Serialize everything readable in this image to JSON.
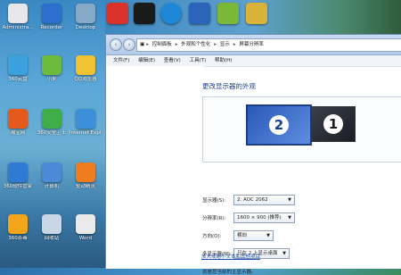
{
  "desktop": {
    "icons": [
      {
        "label": "Administra...",
        "color": "#e7e7ea"
      },
      {
        "label": "Recorder",
        "color": "#2d6fcf"
      },
      {
        "label": "Desktop",
        "color": "#86a9c8"
      },
      {
        "label": "360云盘",
        "color": "#3aa0de"
      },
      {
        "label": "小米",
        "color": "#6cbb3c"
      },
      {
        "label": "QQ浏览器",
        "color": "#f1c232"
      },
      {
        "label": "淘宝网",
        "color": "#e55a1c"
      },
      {
        "label": "360安全卫士",
        "color": "#3fae49"
      },
      {
        "label": "Internet Explorer",
        "color": "#3c8fd9"
      },
      {
        "label": "360软件管家",
        "color": "#2f7ad3"
      },
      {
        "label": "计算机",
        "color": "#4b8ad6"
      },
      {
        "label": "驱动精灵",
        "color": "#ef7d1f"
      },
      {
        "label": "360杀毒",
        "color": "#f3a61a"
      },
      {
        "label": "回收站",
        "color": "#c8d6e6"
      },
      {
        "label": "Word",
        "color": "#eaeaea"
      }
    ],
    "top_icons": [
      {
        "color": "#d8322a"
      },
      {
        "color": "#1a1a1a"
      },
      {
        "color": "#1e88d6"
      },
      {
        "color": "#2b64b8"
      },
      {
        "color": "#7bb83a"
      },
      {
        "color": "#d9b23a"
      }
    ]
  },
  "window": {
    "address": {
      "segments": [
        "控制面板",
        "外观和个性化",
        "显示",
        "屏幕分辨率"
      ]
    },
    "menu": [
      "文件(F)",
      "编辑(E)",
      "查看(V)",
      "工具(T)",
      "帮助(H)"
    ],
    "heading": "更改显示器的外观",
    "monitors": {
      "secondary_num": "2",
      "primary_num": "1"
    },
    "fields": {
      "display_label": "显示器(S):",
      "display_value": "2. AOC 2062",
      "resolution_label": "分辨率(R):",
      "resolution_value": "1600 × 900 (推荐)",
      "orientation_label": "方向(O):",
      "orientation_value": "横向",
      "multi_label": "多显示器(M):",
      "multi_value": "只在 2 上显示桌面"
    },
    "main_display_text": "这是您当前的主显示器。",
    "links": [
      "放大或缩小文本和其他项目"
    ]
  }
}
